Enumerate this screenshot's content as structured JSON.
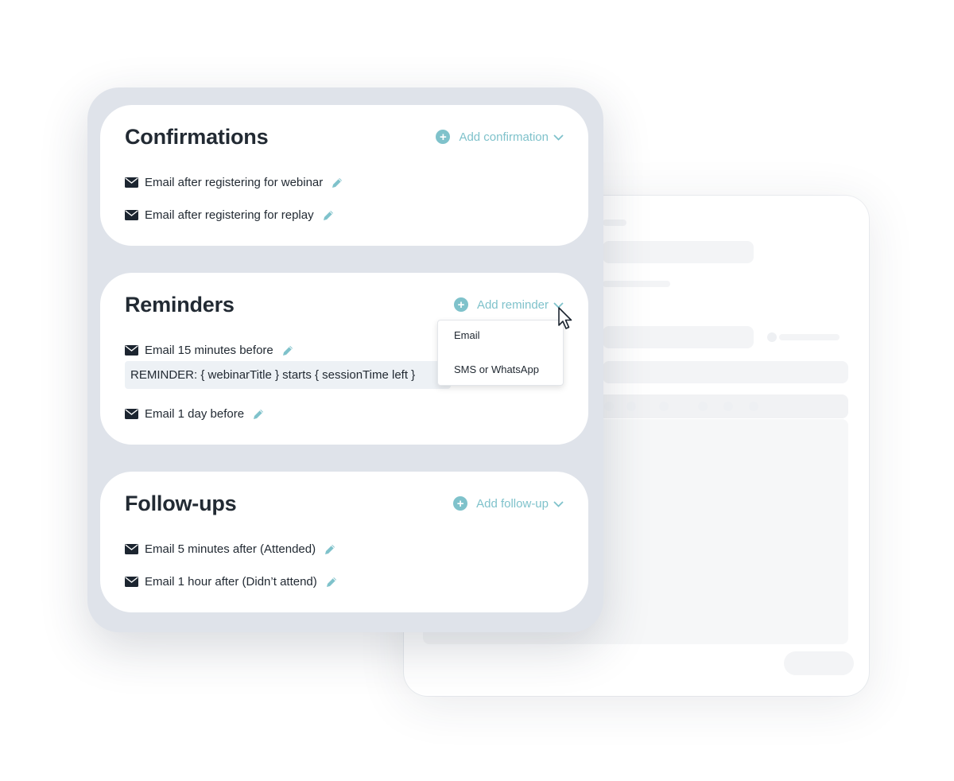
{
  "confirmations": {
    "title": "Confirmations",
    "add_label": "Add confirmation",
    "items": [
      {
        "label": "Email after registering for webinar"
      },
      {
        "label": "Email after registering for replay"
      }
    ]
  },
  "reminders": {
    "title": "Reminders",
    "add_label": "Add reminder",
    "items": [
      {
        "label": "Email 15 minutes before"
      },
      {
        "label": "Email 1 day before"
      }
    ],
    "preview_text": "REMINDER: { webinarTitle } starts { sessionTime left }",
    "dropdown_options": [
      "Email",
      "SMS or WhatsApp"
    ]
  },
  "followups": {
    "title": "Follow-ups",
    "add_label": "Add follow-up",
    "items": [
      {
        "label": "Email 5 minutes after (Attended)"
      },
      {
        "label": "Email 1 hour after (Didn’t attend)"
      }
    ]
  },
  "colors": {
    "accent": "#7fc2cb",
    "panel_bg": "#dfe3ea",
    "text": "#222a33",
    "icon_dark": "#1c2530"
  },
  "icons": [
    "plus-circle-icon",
    "chevron-down-icon",
    "envelope-icon",
    "pencil-icon",
    "mouse-pointer-icon"
  ]
}
